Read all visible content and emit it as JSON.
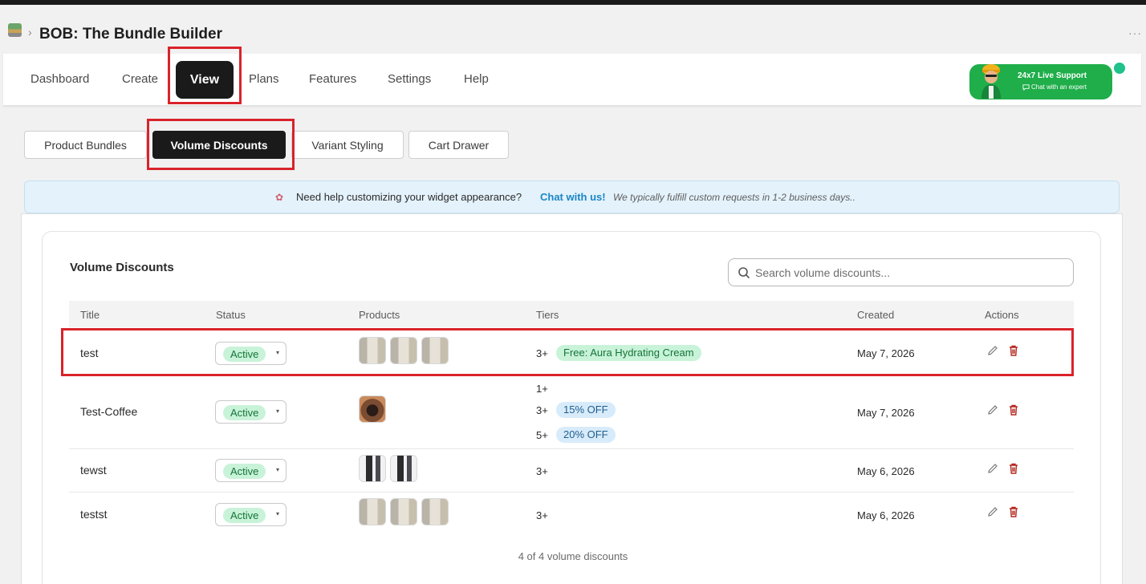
{
  "app": {
    "title": "BOB: The Bundle Builder",
    "more": "···",
    "chevron": "›"
  },
  "nav": {
    "items": [
      "Dashboard",
      "Create",
      "View",
      "Plans",
      "Features",
      "Settings",
      "Help"
    ],
    "active": "View"
  },
  "support": {
    "title": "24x7 Live Support",
    "subtitle": "Chat with an expert"
  },
  "tabs": [
    "Product Bundles",
    "Volume Discounts",
    "Variant Styling",
    "Cart Drawer"
  ],
  "active_tab": "Volume Discounts",
  "banner": {
    "text": "Need help customizing your widget appearance?",
    "link": "Chat with us!",
    "note": "We typically fulfill custom requests in 1-2 business days.."
  },
  "card": {
    "title": "Volume Discounts",
    "search_placeholder": "Search volume discounts..."
  },
  "table": {
    "headers": [
      "Title",
      "Status",
      "Products",
      "Tiers",
      "Created",
      "Actions"
    ],
    "rows": [
      {
        "title": "test",
        "status": "Active",
        "products": [
          "cream-thumbnail",
          "cream-thumbnail",
          "cream-thumbnail"
        ],
        "tiers": [
          {
            "qty": "3+",
            "badge": "Free: Aura Hydrating Cream",
            "badge_color": "#c8f3d8"
          }
        ],
        "created": "May 7, 2026"
      },
      {
        "title": "Test-Coffee",
        "status": "Active",
        "products": [
          "coffee-thumbnail"
        ],
        "tiers": [
          {
            "qty": "1+",
            "badge": ""
          },
          {
            "qty": "3+",
            "badge": "15% OFF",
            "badge_color": "#d8ebfa"
          },
          {
            "qty": "5+",
            "badge": "20% OFF",
            "badge_color": "#d8ebfa"
          }
        ],
        "created": "May 7, 2026"
      },
      {
        "title": "tewst",
        "status": "Active",
        "products": [
          "cup-thumbnail",
          "cup-thumbnail"
        ],
        "tiers": [
          {
            "qty": "3+",
            "badge": ""
          }
        ],
        "created": "May 6, 2026"
      },
      {
        "title": "testst",
        "status": "Active",
        "products": [
          "cream-thumbnail",
          "cream-thumbnail",
          "cream-thumbnail"
        ],
        "tiers": [
          {
            "qty": "3+",
            "badge": ""
          }
        ],
        "created": "May 6, 2026"
      }
    ],
    "footer": "4 of 4 volume discounts"
  },
  "icons": {
    "edit": "pencil-icon",
    "delete": "trash-icon",
    "search": "search-icon",
    "caret": "▾"
  },
  "colors": {
    "accent": "#1a1a1a",
    "highlight": "#d9232b",
    "support": "#1fae4a",
    "link": "#1b86c7",
    "danger": "#b3261e"
  }
}
